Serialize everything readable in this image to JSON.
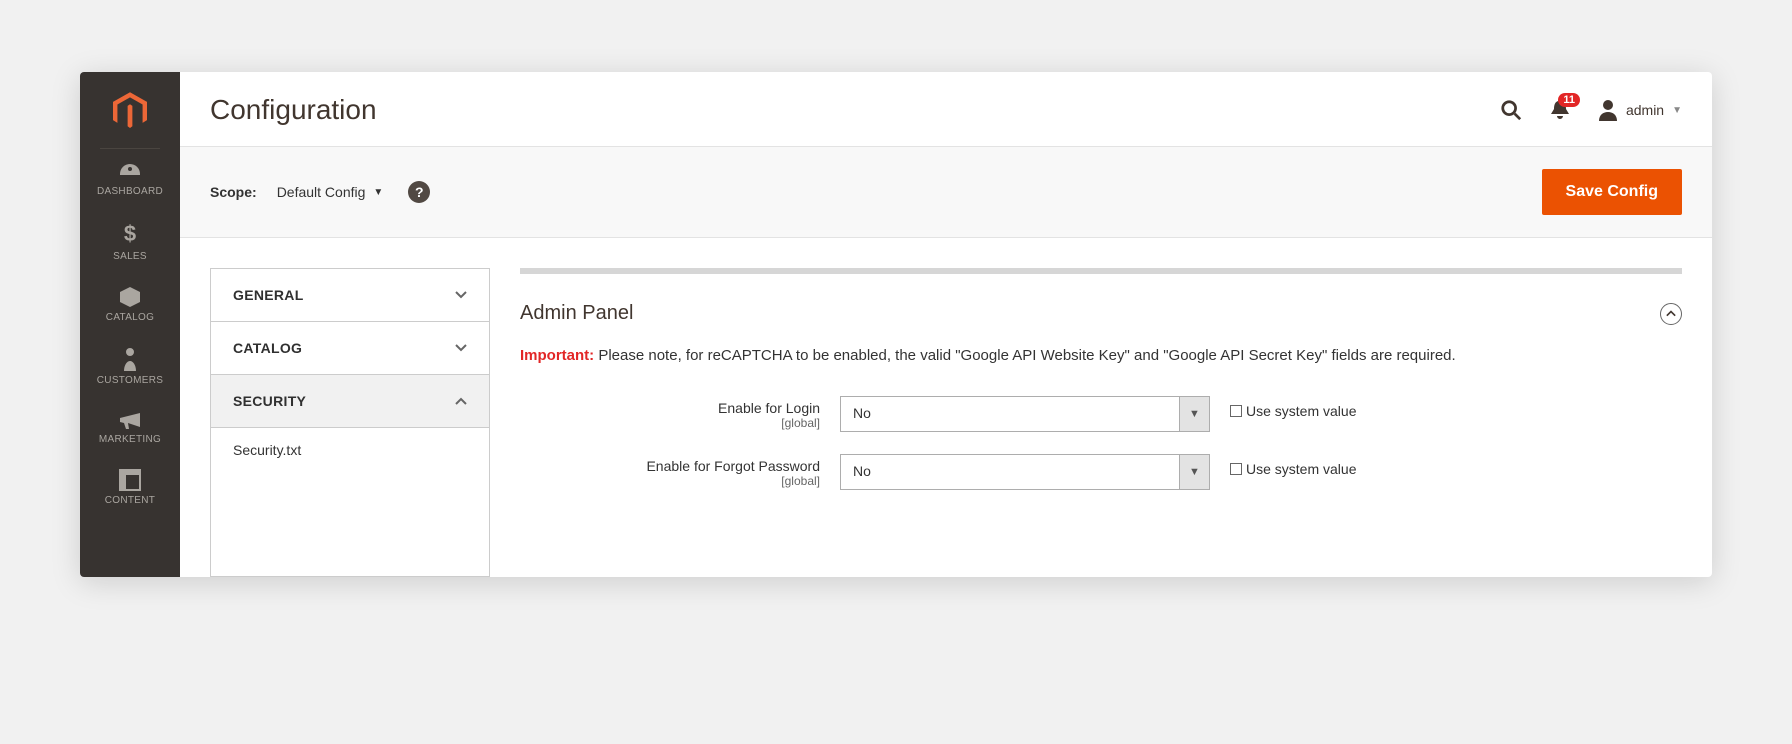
{
  "sidebar": {
    "items": [
      {
        "label": "DASHBOARD"
      },
      {
        "label": "SALES"
      },
      {
        "label": "CATALOG"
      },
      {
        "label": "CUSTOMERS"
      },
      {
        "label": "MARKETING"
      },
      {
        "label": "CONTENT"
      }
    ]
  },
  "header": {
    "title": "Configuration",
    "notif_count": "11",
    "user_label": "admin"
  },
  "toolbar": {
    "scope_label": "Scope:",
    "scope_value": "Default Config",
    "save_label": "Save Config"
  },
  "config_nav": {
    "groups": [
      {
        "label": "GENERAL",
        "expanded": false
      },
      {
        "label": "CATALOG",
        "expanded": false
      },
      {
        "label": "SECURITY",
        "expanded": true,
        "sub": [
          "Security.txt"
        ]
      }
    ]
  },
  "panel": {
    "section_title": "Admin Panel",
    "important_label": "Important:",
    "important_text": " Please note, for reCAPTCHA to be enabled, the valid \"Google API Website Key\" and \"Google API Secret Key\" fields are required.",
    "fields": [
      {
        "label": "Enable for Login",
        "scope": "[global]",
        "value": "No",
        "use_system": "Use system value"
      },
      {
        "label": "Enable for Forgot Password",
        "scope": "[global]",
        "value": "No",
        "use_system": "Use system value"
      }
    ]
  }
}
